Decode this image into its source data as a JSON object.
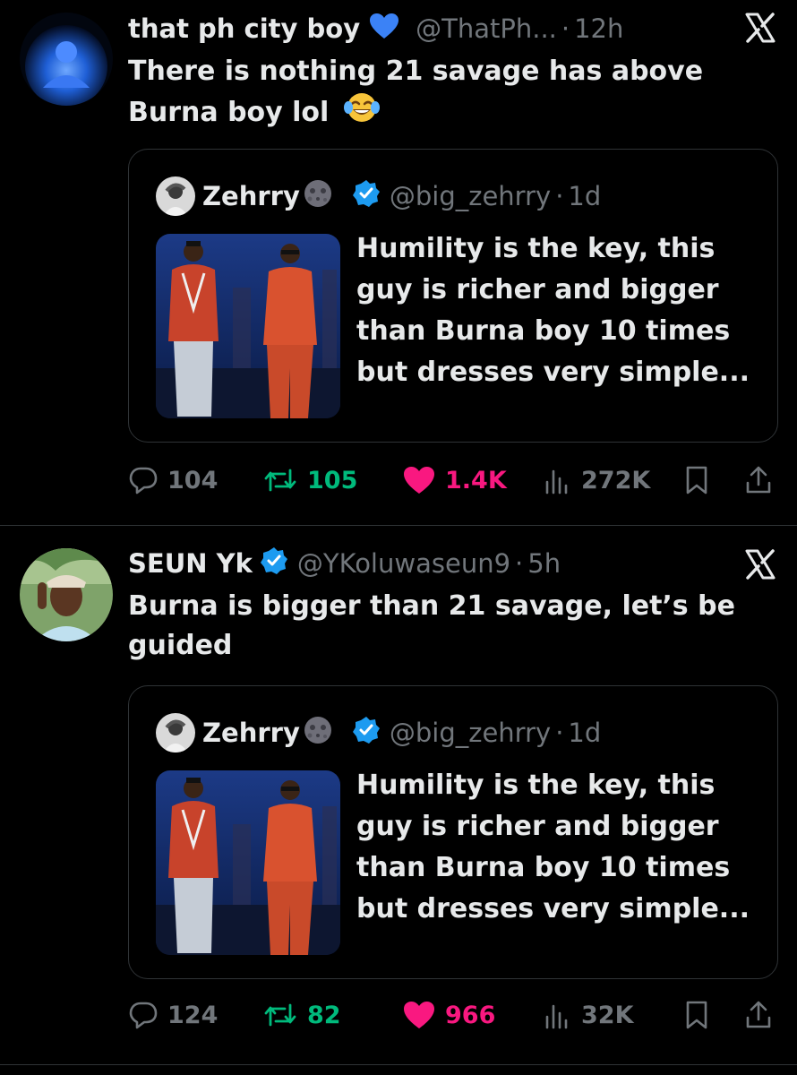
{
  "colors": {
    "bg": "#000000",
    "text": "#e7e9ea",
    "muted": "#71767b",
    "retweet": "#00ba7c",
    "like": "#f91880",
    "verified": "#1d9bf0"
  },
  "tweets": [
    {
      "name": "that ph city boy",
      "name_emoji_icon": "blue-heart-icon",
      "handle": "@ThatPh...",
      "dot": "·",
      "time": "12h",
      "text_line1": "There is nothing 21 savage has above",
      "text_line2": "Burna boy lol",
      "text_emoji_icon": "tears-of-joy-icon",
      "quote": {
        "name": "Zehrry",
        "name_emoji_icon": "new-moon-face-icon",
        "verified_icon": "verified-badge-icon",
        "handle": "@big_zehrry",
        "dot": "·",
        "time": "1d",
        "text": [
          "Humility is the key, this",
          "guy is richer and bigger",
          "than Burna boy 10 times",
          "but dresses very simple..."
        ]
      },
      "actions": {
        "replies": "104",
        "retweets": "105",
        "likes": "1.4K",
        "views": "272K"
      }
    },
    {
      "name": "SEUN Yk",
      "verified_icon": "verified-badge-icon",
      "handle": "@YKoluwaseun9",
      "dot": "·",
      "time": "5h",
      "text_line1": "Burna is bigger than 21 savage, let’s be",
      "text_line2": "guided",
      "quote": {
        "name": "Zehrry",
        "name_emoji_icon": "new-moon-face-icon",
        "verified_icon": "verified-badge-icon",
        "handle": "@big_zehrry",
        "dot": "·",
        "time": "1d",
        "text": [
          "Humility is the key, this",
          "guy is richer and bigger",
          "than Burna boy 10 times",
          "but dresses very simple..."
        ]
      },
      "actions": {
        "replies": "124",
        "retweets": "82",
        "likes": "966",
        "views": "32K"
      }
    }
  ]
}
